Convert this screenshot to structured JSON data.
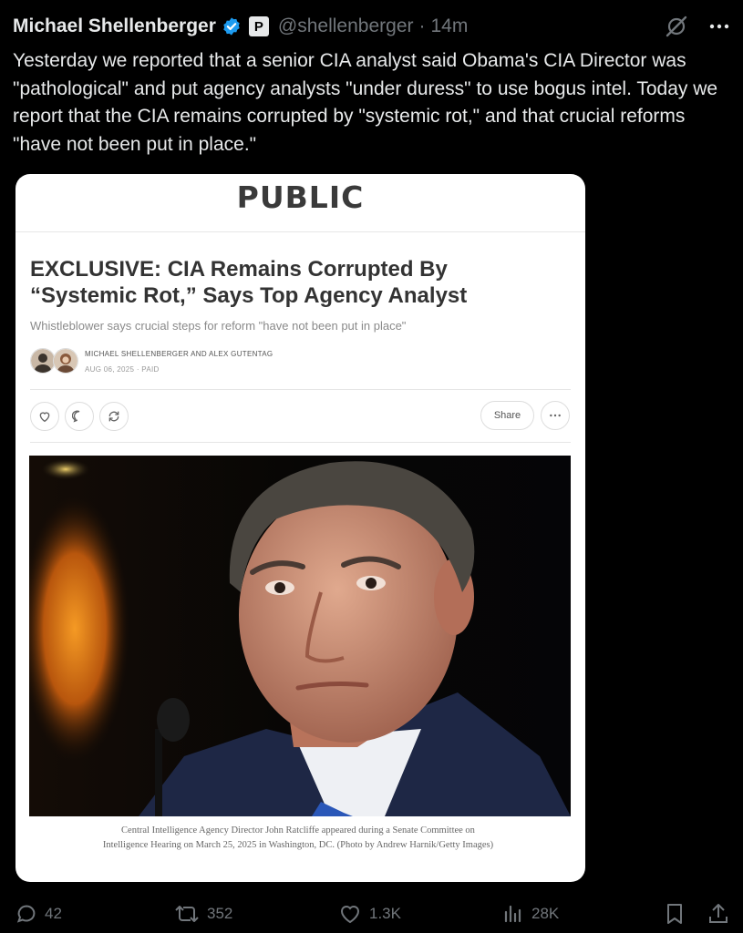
{
  "tweet": {
    "author_name": "Michael Shellenberger",
    "author_handle": "@shellenberger",
    "separator": "·",
    "time": "14m",
    "text": "Yesterday we reported that a senior CIA analyst said Obama's CIA Director was \"pathological\" and put agency analysts \"under duress\" to use bogus intel. Today we report that the CIA remains corrupted by \"systemic rot,\" and that crucial reforms \"have not been put in place.\""
  },
  "badge": {
    "label": "P"
  },
  "card": {
    "publication": "PUBLIC",
    "headline": "EXCLUSIVE: CIA Remains Corrupted By “Systemic Rot,” Says Top Agency Analyst",
    "subtitle": "Whistleblower says crucial steps for reform \"have not been put in place\"",
    "authors": "MICHAEL SHELLENBERGER AND ALEX GUTENTAG",
    "date": "AUG 06, 2025 · PAID",
    "share_label": "Share",
    "caption": "Central Intelligence Agency Director John Ratcliffe appeared during a Senate Committee on Intelligence Hearing on March 25, 2025 in Washington, DC. (Photo by Andrew Harnik/Getty Images)"
  },
  "footer": {
    "replies": "42",
    "reposts": "352",
    "likes": "1.3K",
    "views": "28K"
  },
  "colors": {
    "background": "#000000",
    "text": "#e7e9ea",
    "muted": "#71767b",
    "verified": "#1d9bf0",
    "card_bg": "#ffffff"
  },
  "icons": [
    "verified-badge-icon",
    "grok-icon",
    "more-icon",
    "heart-icon",
    "comment-icon",
    "restack-icon",
    "reply-icon",
    "repost-icon",
    "like-icon",
    "views-icon",
    "bookmark-icon",
    "share-icon"
  ]
}
